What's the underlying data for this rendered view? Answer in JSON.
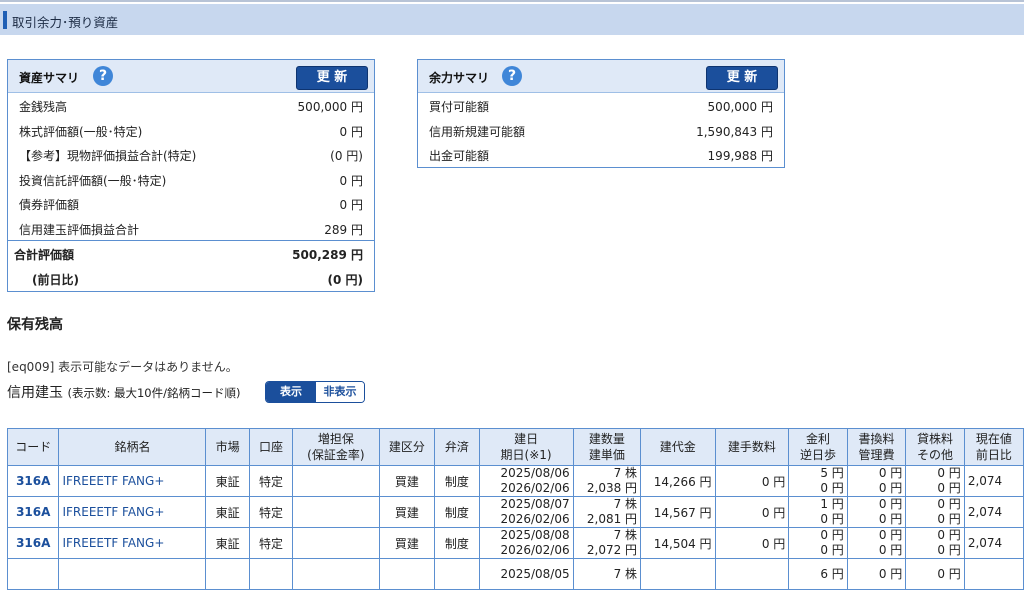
{
  "header": {
    "title": "取引余力･預り資産"
  },
  "asset_summary": {
    "title": "資産サマリ",
    "help": "?",
    "update_label": "更 新",
    "rows": [
      {
        "label": "金銭残高",
        "value": "500,000 円"
      },
      {
        "label": "株式評価額(一般･特定)",
        "value": "0 円"
      },
      {
        "label": "【参考】現物評価損益合計(特定)",
        "value": "(0 円)"
      },
      {
        "label": "投資信託評価額(一般･特定)",
        "value": "0 円"
      },
      {
        "label": "債券評価額",
        "value": "0 円"
      },
      {
        "label": "信用建玉評価損益合計",
        "value": "289 円"
      }
    ],
    "total_label": "合計評価額",
    "total_value": "500,289 円",
    "prev_label": "(前日比)",
    "prev_value": "(0 円)"
  },
  "margin_summary": {
    "title": "余力サマリ",
    "help": "?",
    "update_label": "更 新",
    "rows": [
      {
        "label": "買付可能額",
        "value": "500,000 円"
      },
      {
        "label": "信用新規建可能額",
        "value": "1,590,843 円"
      },
      {
        "label": "出金可能額",
        "value": "199,988 円"
      }
    ]
  },
  "holdings": {
    "title": "保有残高",
    "message": "[eq009] 表示可能なデータはありません。"
  },
  "margin_positions": {
    "title": "信用建玉",
    "subtitle": "(表示数: 最大10件/銘柄コード順)",
    "toggle_on": "表示",
    "toggle_off": "非表示",
    "columns": [
      [
        "コード"
      ],
      [
        "銘柄名"
      ],
      [
        "市場"
      ],
      [
        "口座"
      ],
      [
        "増担保",
        "(保証金率)"
      ],
      [
        "建区分"
      ],
      [
        "弁済"
      ],
      [
        "建日",
        "期日(※1)"
      ],
      [
        "建数量",
        "建単価"
      ],
      [
        "建代金"
      ],
      [
        "建手数料"
      ],
      [
        "金利",
        "逆日歩"
      ],
      [
        "書換料",
        "管理費"
      ],
      [
        "貸株料",
        "その他"
      ],
      [
        "現在値",
        "前日比"
      ]
    ],
    "rows": [
      {
        "code": "316A",
        "name": "IFREEETF FANG+",
        "market": "東証",
        "account": "特定",
        "collateral": "",
        "type": "買建",
        "repay": "制度",
        "date1": "2025/08/06",
        "date2": "2026/02/06",
        "qty": "7 株",
        "price": "2,038 円",
        "amount": "14,266 円",
        "fee": "0 円",
        "int1": "5 円",
        "int2": "0 円",
        "rw1": "0 円",
        "rw2": "0 円",
        "ln1": "0 円",
        "ln2": "0 円",
        "cur": "2,074"
      },
      {
        "code": "316A",
        "name": "IFREEETF FANG+",
        "market": "東証",
        "account": "特定",
        "collateral": "",
        "type": "買建",
        "repay": "制度",
        "date1": "2025/08/07",
        "date2": "2026/02/06",
        "qty": "7 株",
        "price": "2,081 円",
        "amount": "14,567 円",
        "fee": "0 円",
        "int1": "1 円",
        "int2": "0 円",
        "rw1": "0 円",
        "rw2": "0 円",
        "ln1": "0 円",
        "ln2": "0 円",
        "cur": "2,074"
      },
      {
        "code": "316A",
        "name": "IFREEETF FANG+",
        "market": "東証",
        "account": "特定",
        "collateral": "",
        "type": "買建",
        "repay": "制度",
        "date1": "2025/08/08",
        "date2": "2026/02/06",
        "qty": "7 株",
        "price": "2,072 円",
        "amount": "14,504 円",
        "fee": "0 円",
        "int1": "0 円",
        "int2": "0 円",
        "rw1": "0 円",
        "rw2": "0 円",
        "ln1": "0 円",
        "ln2": "0 円",
        "cur": "2,074"
      },
      {
        "code": "",
        "name": "",
        "market": "",
        "account": "",
        "collateral": "",
        "type": "",
        "repay": "",
        "date1": "2025/08/05",
        "date2": "",
        "qty": "7 株",
        "price": "",
        "amount": "",
        "fee": "",
        "int1": "6 円",
        "int2": "",
        "rw1": "0 円",
        "rw2": "",
        "ln1": "0 円",
        "ln2": "",
        "cur": ""
      }
    ]
  }
}
